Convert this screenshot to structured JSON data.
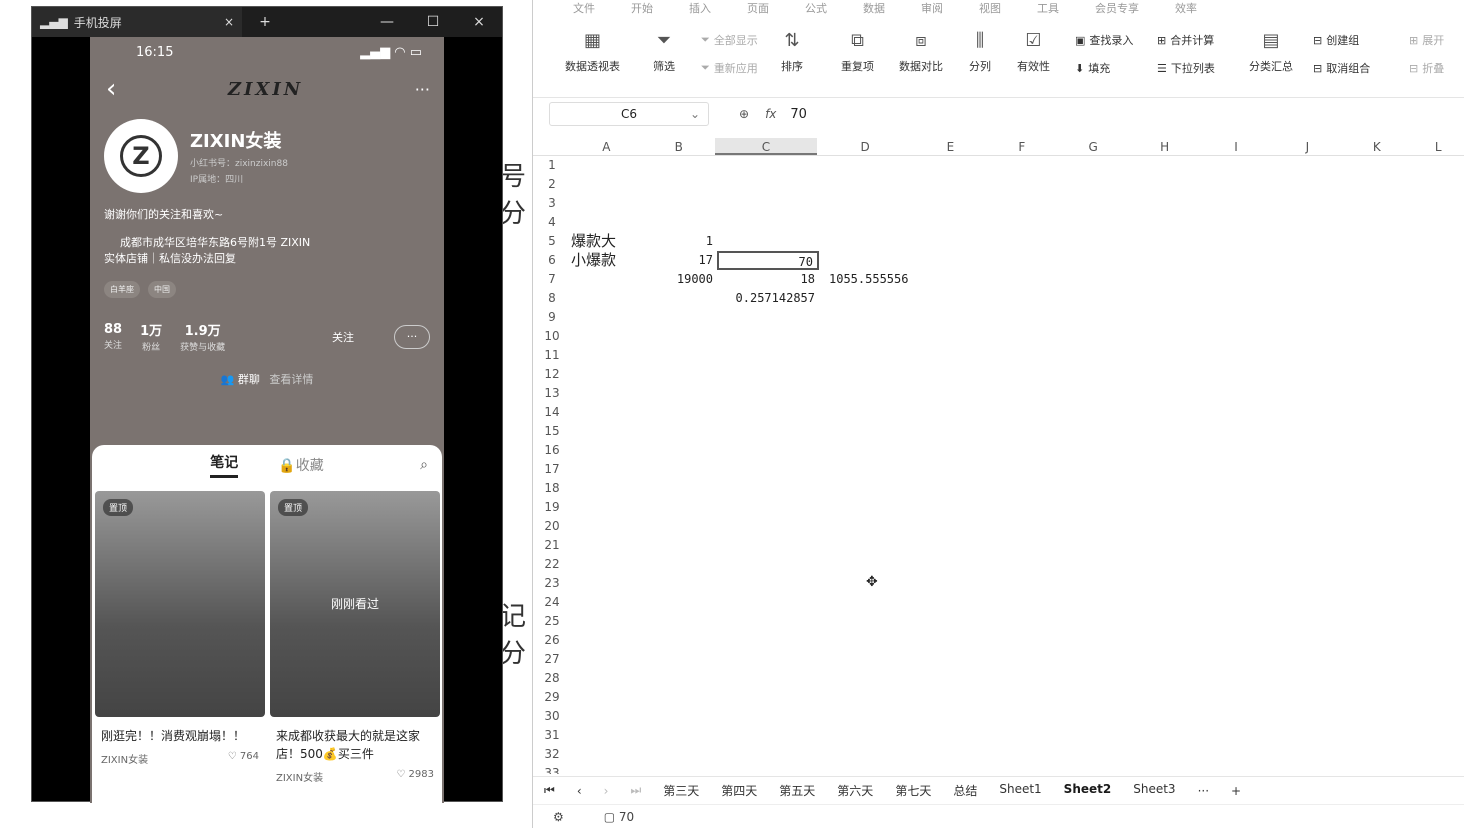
{
  "mirror": {
    "title": "手机投屏",
    "new_tab": "+",
    "close_tab": "×",
    "win_min": "—",
    "win_max": "☐",
    "win_close": "×"
  },
  "background_text": [
    "号分",
    "记分"
  ],
  "phone": {
    "time": "16:15",
    "logo": "ZIXIN",
    "back": "‹",
    "more": "···",
    "name": "ZIXIN女装",
    "id_line": "小红书号：zixinzixin88",
    "ip_line": "IP属地：四川",
    "bio": "谢谢你们的关注和喜欢~",
    "address_line1": "成都市成华区培华东路6号附1号 ZIXIN",
    "address_line2": "实体店铺｜私信没办法回复",
    "tags": [
      "白羊座",
      "中国"
    ],
    "stats": [
      {
        "value": "88",
        "label": "关注"
      },
      {
        "value": "1万",
        "label": "粉丝"
      },
      {
        "value": "1.9万",
        "label": "获赞与收藏"
      }
    ],
    "follow_btn": "关注",
    "group_chat": "群聊",
    "group_detail": "查看详情",
    "tab_notes": "笔记",
    "tab_collect": "收藏",
    "cards": [
      {
        "pin": "置顶",
        "seen": "",
        "title": "刚逛完！！消费观崩塌！！",
        "author": "ZIXIN女装",
        "likes": "764"
      },
      {
        "pin": "置顶",
        "seen": "刚刚看过",
        "title": "来成都收获最大的就是这家店！500💰买三件",
        "author": "ZIXIN女装",
        "likes": "2983"
      }
    ]
  },
  "ribbon": {
    "menu": [
      "文件",
      "开始",
      "插入",
      "页面",
      "公式",
      "数据",
      "审阅",
      "视图",
      "工具",
      "会员专享",
      "效率"
    ],
    "buttons": {
      "pivot": "数据透视表",
      "filter": "筛选",
      "show_all": "全部显示",
      "reapply": "重新应用",
      "sort": "排序",
      "duplicates": "重复项",
      "compare": "数据对比",
      "split": "分列",
      "validity": "有效性",
      "lookup": "查找录入",
      "fill": "填充",
      "consolidate": "合并计算",
      "dropdown": "下拉列表",
      "subtotal": "分类汇总",
      "group": "创建组",
      "ungroup": "取消组合",
      "expand": "展开",
      "collapse": "折叠"
    }
  },
  "formula": {
    "namebox": "C6",
    "fx": "fx",
    "value": "70"
  },
  "columns": [
    "A",
    "B",
    "C",
    "D",
    "E",
    "F",
    "G",
    "H",
    "I",
    "J",
    "K",
    "L"
  ],
  "rows": [
    {
      "n": "1",
      "a": "",
      "b": "",
      "c": "",
      "d": ""
    },
    {
      "n": "2",
      "a": "",
      "b": "",
      "c": "",
      "d": ""
    },
    {
      "n": "3",
      "a": "",
      "b": "",
      "c": "",
      "d": ""
    },
    {
      "n": "4",
      "a": "",
      "b": "",
      "c": "",
      "d": ""
    },
    {
      "n": "5",
      "a": "爆款大",
      "b": "1",
      "c": "",
      "d": ""
    },
    {
      "n": "6",
      "a": "小爆款",
      "b": "17",
      "c": "70",
      "d": ""
    },
    {
      "n": "7",
      "a": "",
      "b": "19000",
      "c": "18",
      "d": "1055.555556"
    },
    {
      "n": "8",
      "a": "",
      "b": "",
      "c": "0.257142857",
      "d": ""
    },
    {
      "n": "9"
    },
    {
      "n": "10"
    },
    {
      "n": "11"
    },
    {
      "n": "12"
    },
    {
      "n": "13"
    },
    {
      "n": "14"
    },
    {
      "n": "15"
    },
    {
      "n": "16"
    },
    {
      "n": "17"
    },
    {
      "n": "18"
    },
    {
      "n": "19"
    },
    {
      "n": "20"
    },
    {
      "n": "21"
    },
    {
      "n": "22"
    },
    {
      "n": "23"
    },
    {
      "n": "24"
    },
    {
      "n": "25"
    },
    {
      "n": "26"
    },
    {
      "n": "27"
    },
    {
      "n": "28"
    },
    {
      "n": "29"
    },
    {
      "n": "30"
    },
    {
      "n": "31"
    },
    {
      "n": "32"
    },
    {
      "n": "33"
    }
  ],
  "sheet_tabs": [
    "第三天",
    "第四天",
    "第五天",
    "第六天",
    "第七天",
    "总结",
    "Sheet1",
    "Sheet2",
    "Sheet3"
  ],
  "active_sheet": "Sheet2",
  "more_tabs": "···",
  "add_sheet": "+",
  "status_value": "70",
  "colors": {
    "accent": "#217346",
    "phone_bg": "#7b7370"
  }
}
